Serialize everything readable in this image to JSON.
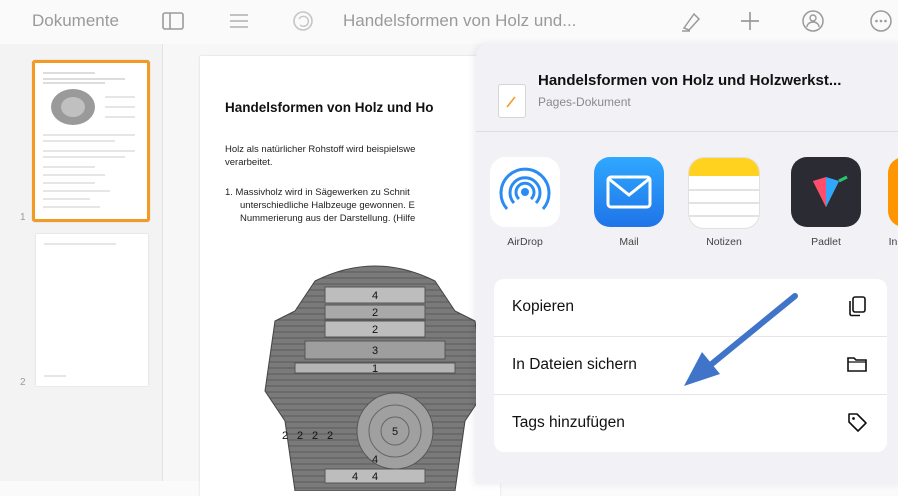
{
  "toolbar": {
    "back_label": "Dokumente",
    "doc_title": "Handelsformen von Holz und..."
  },
  "sidebar": {
    "pages": [
      {
        "number": "1"
      },
      {
        "number": "2"
      }
    ]
  },
  "document": {
    "title": "Handelsformen von Holz und Ho",
    "para1_line1": "Holz als natürlicher Rohstoff wird beispielswe",
    "para1_line2": "verarbeitet.",
    "item1_line1": "1.  Massivholz wird in Sägewerken zu Schnit",
    "item1_line2": "unterschiedliche Halbzeuge gewonnen. E",
    "item1_line3": "Nummerierung aus der Darstellung. (Hilfe",
    "diagram_labels": [
      "4",
      "2",
      "2",
      "3",
      "1",
      "2",
      "2",
      "2",
      "2",
      "5",
      "4",
      "4",
      "4"
    ]
  },
  "share_sheet": {
    "title": "Handelsformen von Holz und Holzwerkst...",
    "subtitle": "Pages-Dokument",
    "apps": [
      {
        "label": "AirDrop",
        "icon": "airdrop-icon"
      },
      {
        "label": "Mail",
        "icon": "mail-icon"
      },
      {
        "label": "Notizen",
        "icon": "notes-icon"
      },
      {
        "label": "Padlet",
        "icon": "padlet-icon"
      },
      {
        "label": "In",
        "icon": "app-icon"
      }
    ],
    "actions": [
      {
        "label": "Kopieren",
        "icon": "copy-icon"
      },
      {
        "label": "In Dateien sichern",
        "icon": "folder-icon"
      },
      {
        "label": "Tags hinzufügen",
        "icon": "tag-icon"
      }
    ]
  },
  "colors": {
    "selection": "#f29a24",
    "arrow": "#3f74c9",
    "mail_blue": "#2a8cf3",
    "notes_yellow": "#ffd21f"
  }
}
